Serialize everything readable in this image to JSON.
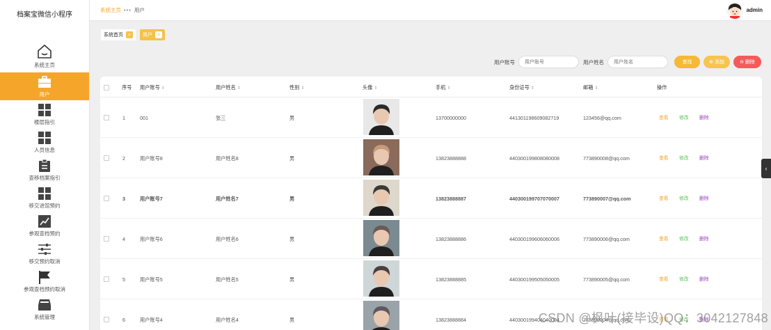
{
  "app": {
    "title": "档案宝微信小程序"
  },
  "sidebar": {
    "items": [
      {
        "label": "系统主页",
        "icon": "home-icon"
      },
      {
        "label": "用户",
        "icon": "briefcase-icon"
      },
      {
        "label": "楼层指引",
        "icon": "grid-icon"
      },
      {
        "label": "人员信息",
        "icon": "grid-icon"
      },
      {
        "label": "查移档案指引",
        "icon": "clipboard-icon"
      },
      {
        "label": "移交进馆预约",
        "icon": "grid-icon"
      },
      {
        "label": "参观查档预约",
        "icon": "chart-line-icon"
      },
      {
        "label": "移交预约取消",
        "icon": "sliders-icon"
      },
      {
        "label": "参观查档预约取消",
        "icon": "flag-icon"
      },
      {
        "label": "系统管理",
        "icon": "inbox-icon"
      }
    ]
  },
  "header": {
    "breadcrumb": {
      "home": "系统主页",
      "current": "用户"
    },
    "user": "admin"
  },
  "tags": {
    "home": "系统首页",
    "current": "用户"
  },
  "search": {
    "account_label": "用户账号",
    "account_placeholder": "用户账号",
    "name_label": "用户姓名",
    "name_placeholder": "用户姓名",
    "search_button": "查找",
    "add_button": "⊕ 添加",
    "delete_button": "⊖ 删除"
  },
  "table": {
    "headers": {
      "index": "序号",
      "account": "用户账号",
      "name": "用户姓名",
      "gender": "性别",
      "avatar": "头像",
      "phone": "手机",
      "id_card": "身份证号",
      "email": "邮箱",
      "actions": "操作"
    },
    "actions": {
      "view": "查看",
      "edit": "修改",
      "delete": "删除"
    },
    "rows": [
      {
        "index": "1",
        "account": "001",
        "name": "张三",
        "gender": "男",
        "phone": "13700000000",
        "id_card": "441301198609082719",
        "email": "123456@qq.com"
      },
      {
        "index": "2",
        "account": "用户账号8",
        "name": "用户姓名8",
        "gender": "男",
        "phone": "13823888888",
        "id_card": "440300199808080008",
        "email": "773890008@qq.com"
      },
      {
        "index": "3",
        "account": "用户账号7",
        "name": "用户姓名7",
        "gender": "男",
        "phone": "13823888887",
        "id_card": "440300199707070007",
        "email": "773890007@qq.com"
      },
      {
        "index": "4",
        "account": "用户账号6",
        "name": "用户姓名6",
        "gender": "男",
        "phone": "13823888886",
        "id_card": "440300199606060006",
        "email": "773890006@qq.com"
      },
      {
        "index": "5",
        "account": "用户账号5",
        "name": "用户姓名5",
        "gender": "男",
        "phone": "13823888885",
        "id_card": "440300199505050005",
        "email": "773890005@qq.com"
      },
      {
        "index": "6",
        "account": "用户账号4",
        "name": "用户姓名4",
        "gender": "男",
        "phone": "13823888884",
        "id_card": "440300199404040004",
        "email": "773890004@qq.com"
      }
    ]
  },
  "watermark": "CSDN @枫叶(接毕设)QQ：3042127848",
  "colors": {
    "accent": "#f5a62a",
    "danger": "#f55b5b",
    "edit": "#5bbf5b",
    "delete_link": "#a040c0"
  }
}
